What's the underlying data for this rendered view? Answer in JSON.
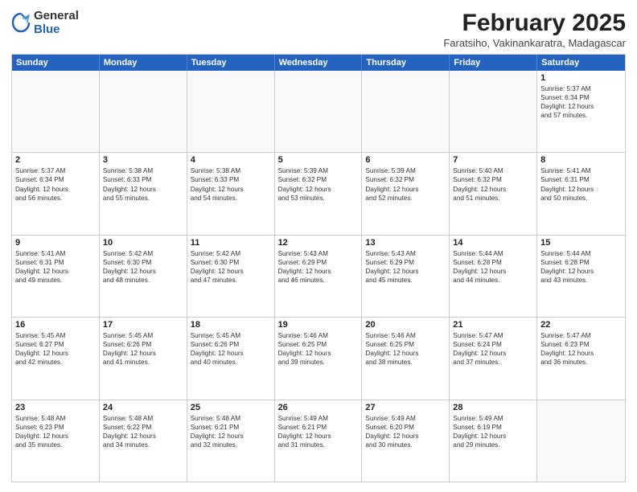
{
  "header": {
    "logo_general": "General",
    "logo_blue": "Blue",
    "title": "February 2025",
    "subtitle": "Faratsiho, Vakinankaratra, Madagascar"
  },
  "day_headers": [
    "Sunday",
    "Monday",
    "Tuesday",
    "Wednesday",
    "Thursday",
    "Friday",
    "Saturday"
  ],
  "weeks": [
    [
      {
        "day": "",
        "info": ""
      },
      {
        "day": "",
        "info": ""
      },
      {
        "day": "",
        "info": ""
      },
      {
        "day": "",
        "info": ""
      },
      {
        "day": "",
        "info": ""
      },
      {
        "day": "",
        "info": ""
      },
      {
        "day": "1",
        "info": "Sunrise: 5:37 AM\nSunset: 6:34 PM\nDaylight: 12 hours\nand 57 minutes."
      }
    ],
    [
      {
        "day": "2",
        "info": "Sunrise: 5:37 AM\nSunset: 6:34 PM\nDaylight: 12 hours\nand 56 minutes."
      },
      {
        "day": "3",
        "info": "Sunrise: 5:38 AM\nSunset: 6:33 PM\nDaylight: 12 hours\nand 55 minutes."
      },
      {
        "day": "4",
        "info": "Sunrise: 5:38 AM\nSunset: 6:33 PM\nDaylight: 12 hours\nand 54 minutes."
      },
      {
        "day": "5",
        "info": "Sunrise: 5:39 AM\nSunset: 6:32 PM\nDaylight: 12 hours\nand 53 minutes."
      },
      {
        "day": "6",
        "info": "Sunrise: 5:39 AM\nSunset: 6:32 PM\nDaylight: 12 hours\nand 52 minutes."
      },
      {
        "day": "7",
        "info": "Sunrise: 5:40 AM\nSunset: 6:32 PM\nDaylight: 12 hours\nand 51 minutes."
      },
      {
        "day": "8",
        "info": "Sunrise: 5:41 AM\nSunset: 6:31 PM\nDaylight: 12 hours\nand 50 minutes."
      }
    ],
    [
      {
        "day": "9",
        "info": "Sunrise: 5:41 AM\nSunset: 6:31 PM\nDaylight: 12 hours\nand 49 minutes."
      },
      {
        "day": "10",
        "info": "Sunrise: 5:42 AM\nSunset: 6:30 PM\nDaylight: 12 hours\nand 48 minutes."
      },
      {
        "day": "11",
        "info": "Sunrise: 5:42 AM\nSunset: 6:30 PM\nDaylight: 12 hours\nand 47 minutes."
      },
      {
        "day": "12",
        "info": "Sunrise: 5:43 AM\nSunset: 6:29 PM\nDaylight: 12 hours\nand 46 minutes."
      },
      {
        "day": "13",
        "info": "Sunrise: 5:43 AM\nSunset: 6:29 PM\nDaylight: 12 hours\nand 45 minutes."
      },
      {
        "day": "14",
        "info": "Sunrise: 5:44 AM\nSunset: 6:28 PM\nDaylight: 12 hours\nand 44 minutes."
      },
      {
        "day": "15",
        "info": "Sunrise: 5:44 AM\nSunset: 6:28 PM\nDaylight: 12 hours\nand 43 minutes."
      }
    ],
    [
      {
        "day": "16",
        "info": "Sunrise: 5:45 AM\nSunset: 6:27 PM\nDaylight: 12 hours\nand 42 minutes."
      },
      {
        "day": "17",
        "info": "Sunrise: 5:45 AM\nSunset: 6:26 PM\nDaylight: 12 hours\nand 41 minutes."
      },
      {
        "day": "18",
        "info": "Sunrise: 5:45 AM\nSunset: 6:26 PM\nDaylight: 12 hours\nand 40 minutes."
      },
      {
        "day": "19",
        "info": "Sunrise: 5:46 AM\nSunset: 6:25 PM\nDaylight: 12 hours\nand 39 minutes."
      },
      {
        "day": "20",
        "info": "Sunrise: 5:46 AM\nSunset: 6:25 PM\nDaylight: 12 hours\nand 38 minutes."
      },
      {
        "day": "21",
        "info": "Sunrise: 5:47 AM\nSunset: 6:24 PM\nDaylight: 12 hours\nand 37 minutes."
      },
      {
        "day": "22",
        "info": "Sunrise: 5:47 AM\nSunset: 6:23 PM\nDaylight: 12 hours\nand 36 minutes."
      }
    ],
    [
      {
        "day": "23",
        "info": "Sunrise: 5:48 AM\nSunset: 6:23 PM\nDaylight: 12 hours\nand 35 minutes."
      },
      {
        "day": "24",
        "info": "Sunrise: 5:48 AM\nSunset: 6:22 PM\nDaylight: 12 hours\nand 34 minutes."
      },
      {
        "day": "25",
        "info": "Sunrise: 5:48 AM\nSunset: 6:21 PM\nDaylight: 12 hours\nand 32 minutes."
      },
      {
        "day": "26",
        "info": "Sunrise: 5:49 AM\nSunset: 6:21 PM\nDaylight: 12 hours\nand 31 minutes."
      },
      {
        "day": "27",
        "info": "Sunrise: 5:49 AM\nSunset: 6:20 PM\nDaylight: 12 hours\nand 30 minutes."
      },
      {
        "day": "28",
        "info": "Sunrise: 5:49 AM\nSunset: 6:19 PM\nDaylight: 12 hours\nand 29 minutes."
      },
      {
        "day": "",
        "info": ""
      }
    ]
  ]
}
